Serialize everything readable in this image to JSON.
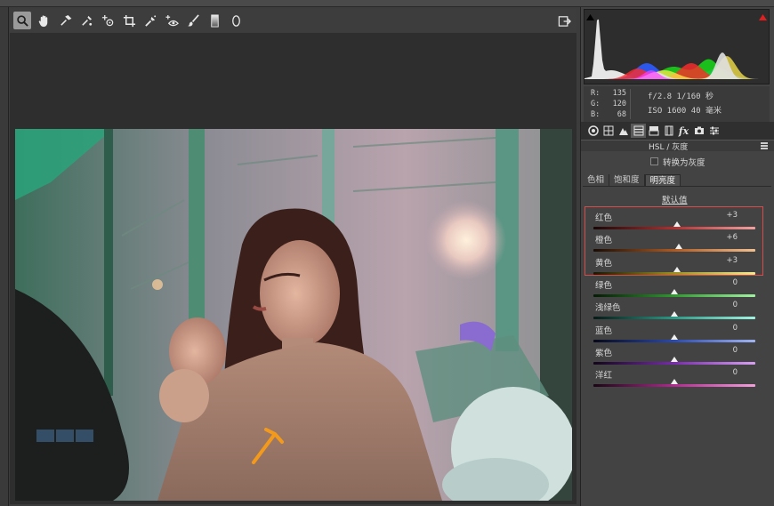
{
  "toolbar": {
    "tools": [
      {
        "name": "zoom-tool",
        "icon": "magnifier-icon"
      },
      {
        "name": "hand-tool",
        "icon": "hand-icon"
      },
      {
        "name": "white-balance-tool",
        "icon": "eyedropper-icon"
      },
      {
        "name": "color-sampler-tool",
        "icon": "sampler-icon"
      },
      {
        "name": "target-adjust-tool",
        "icon": "target-icon"
      },
      {
        "name": "crop-tool",
        "icon": "crop-icon"
      },
      {
        "name": "spot-removal-tool",
        "icon": "brush-spot-icon"
      },
      {
        "name": "red-eye-tool",
        "icon": "eye-icon"
      },
      {
        "name": "adjustment-brush-tool",
        "icon": "brush-icon"
      },
      {
        "name": "graduated-filter-tool",
        "icon": "gradient-icon"
      },
      {
        "name": "radial-filter-tool",
        "icon": "ellipse-icon"
      }
    ]
  },
  "readout": {
    "r_label": "R:",
    "r_value": "135",
    "g_label": "G:",
    "g_value": "120",
    "b_label": "B:",
    "b_value": "68",
    "line1": "f/2.8  1/160 秒",
    "line2": "ISO 1600  40 毫米"
  },
  "panel": {
    "section_title": "HSL / 灰度",
    "convert_gray_label": "转换为灰度",
    "subtabs": [
      "色相",
      "饱和度",
      "明亮度"
    ],
    "active_subtab": 2,
    "default_link": "默认值"
  },
  "sliders": [
    {
      "label": "红色",
      "value": "+3",
      "amount": 3
    },
    {
      "label": "橙色",
      "value": "+6",
      "amount": 6
    },
    {
      "label": "黄色",
      "value": "+3",
      "amount": 3
    },
    {
      "label": "绿色",
      "value": "0",
      "amount": 0
    },
    {
      "label": "浅绿色",
      "value": "0",
      "amount": 0
    },
    {
      "label": "蓝色",
      "value": "0",
      "amount": 0
    },
    {
      "label": "紫色",
      "value": "0",
      "amount": 0
    },
    {
      "label": "洋红",
      "value": "0",
      "amount": 0
    }
  ],
  "colors": {
    "highlight_border": "#d94b4b",
    "clip_shadow": "#000000",
    "clip_highlight": "#e02020"
  }
}
